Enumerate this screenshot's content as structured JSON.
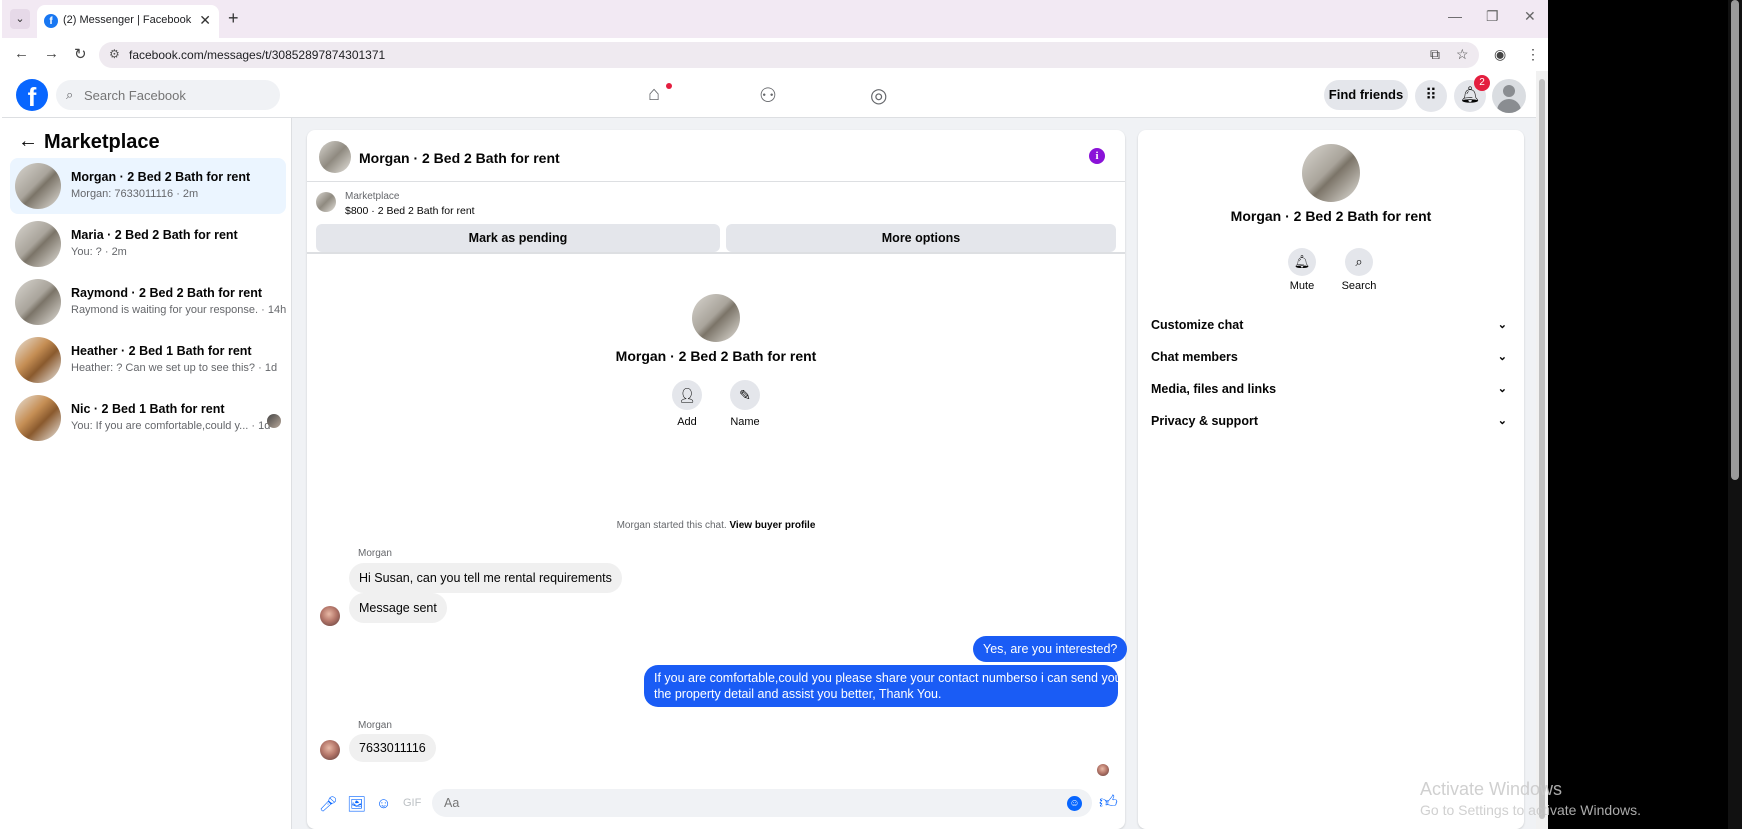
{
  "browser": {
    "tab_title": "(2) Messenger | Facebook",
    "url": "facebook.com/messages/t/30852897874301371",
    "new_tab": "+",
    "tab_close": "✕"
  },
  "header": {
    "search_placeholder": "Search Facebook",
    "find_friends": "Find friends",
    "notification_count": "2"
  },
  "sidebar": {
    "title": "Marketplace",
    "conversations": [
      {
        "name": "Morgan · 2 Bed 2 Bath for rent",
        "preview": "Morgan: 7633011116 · 2m"
      },
      {
        "name": "Maria · 2 Bed 2 Bath for rent",
        "preview": "You: ? · 2m"
      },
      {
        "name": "Raymond · 2 Bed 2 Bath for rent",
        "preview": "Raymond is waiting for your response. · 14h"
      },
      {
        "name": "Heather · 2 Bed 1 Bath for rent",
        "preview": "Heather: ? Can we set up to see this? · 1d"
      },
      {
        "name": "Nic · 2 Bed 1 Bath for rent",
        "preview": "You: If you are comfortable,could y...  · 1d"
      }
    ]
  },
  "chat": {
    "title": "Morgan · 2 Bed 2 Bath for rent",
    "listing_label": "Marketplace",
    "listing_price": "$800 · 2 Bed 2 Bath for rent",
    "mark_pending": "Mark as pending",
    "more_options": "More options",
    "intro_title": "Morgan · 2 Bed 2 Bath for rent",
    "add_label": "Add",
    "name_label": "Name",
    "started_text": "Morgan started this chat.",
    "view_profile": "View buyer profile",
    "messages": [
      {
        "sender": "Morgan",
        "text": "Hi Susan, can you tell me rental requirements"
      },
      {
        "text": "Message sent"
      },
      {
        "text": "Yes, are you interested?"
      },
      {
        "line1": "If you are comfortable,could you please share your contact numberso i can send you",
        "line2": "the property detail and assist you better, Thank You."
      },
      {
        "sender": "Morgan",
        "text": "7633011116"
      }
    ],
    "input_placeholder": "Aa"
  },
  "right_panel": {
    "title": "Morgan · 2 Bed 2 Bath for rent",
    "mute_label": "Mute",
    "search_label": "Search",
    "rows": [
      "Customize chat",
      "Chat members",
      "Media, files and links",
      "Privacy & support"
    ]
  },
  "watermark": {
    "line1": "Activate Windows",
    "line2": "Go to Settings to activate Windows."
  },
  "colors": {
    "fb_blue": "#0866ff",
    "outgoing_bubble": "#1a5cf5",
    "badge_red": "#e41e3f",
    "info_purple": "#8a12d8"
  }
}
